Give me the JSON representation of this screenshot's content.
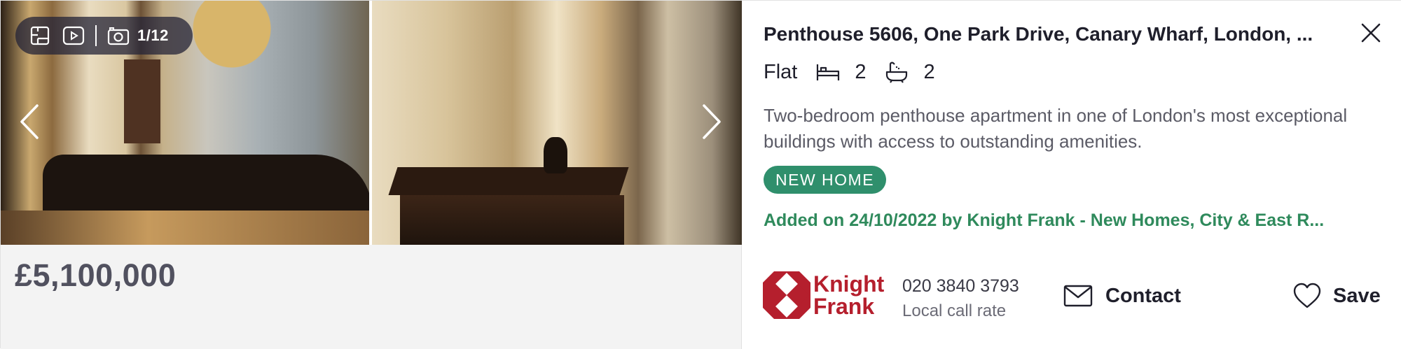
{
  "listing": {
    "media": {
      "photo_counter": "1/12",
      "toolbar_icons": [
        "floorplan-icon",
        "video-icon",
        "camera-icon"
      ],
      "nav": {
        "prev": "chevron-left-icon",
        "next": "chevron-right-icon"
      }
    },
    "price": "£5,100,000",
    "title": "Penthouse 5606, One Park Drive, Canary Wharf, London, ...",
    "property_type": "Flat",
    "bedrooms": "2",
    "bathrooms": "2",
    "description": "Two-bedroom penthouse apartment in one of London's most exceptional buildings with access to outstanding amenities.",
    "badge": "NEW HOME",
    "added_text": "Added on 24/10/2022 by Knight Frank - New Homes, City & East R...",
    "agent": {
      "logo_line1": "Knight",
      "logo_line2": "Frank",
      "phone": "020 3840 3793",
      "phone_note": "Local call rate"
    },
    "actions": {
      "contact_label": "Contact",
      "save_label": "Save"
    },
    "colors": {
      "badge_bg": "#2f8f6c",
      "added_text": "#2f8a5c",
      "agent_brand": "#b51f2d",
      "price_text": "#51515f"
    }
  }
}
